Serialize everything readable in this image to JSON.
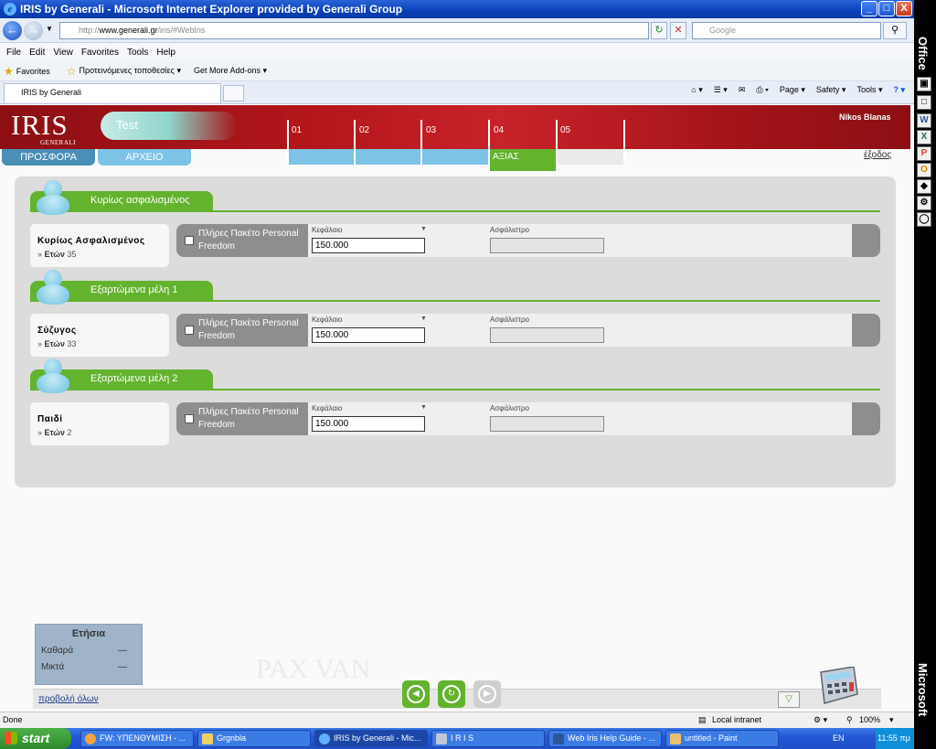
{
  "window": {
    "title": "IRIS by Generali - Microsoft Internet Explorer provided by Generali Group",
    "min_label": "_",
    "max_label": "□",
    "close_label": "X"
  },
  "address_bar": {
    "url_prefix": "http://",
    "url_host": "www.generali.gr",
    "url_path": "/iris/#WebIris",
    "search_placeholder": "Google"
  },
  "menu": [
    "File",
    "Edit",
    "View",
    "Favorites",
    "Tools",
    "Help"
  ],
  "favorites_bar": {
    "favorites": "Favorites",
    "suggested": "Προτεινόμενες τοποθεσίες ▾",
    "addons": "Get More Add-ons ▾"
  },
  "browser_tab": {
    "label": "IRIS by Generali"
  },
  "command_bar": [
    "Page ▾",
    "Safety ▾",
    "Tools ▾"
  ],
  "office_bar": {
    "top_label": "Office",
    "bottom_label": "Microsoft"
  },
  "app": {
    "logo": "IRIS",
    "logo_sub": "GENERALI",
    "project": "Test",
    "user": "Nikos Blanas",
    "steps": [
      "01",
      "02",
      "03",
      "04",
      "05"
    ],
    "active_step": "ΑΞΙΑΣ",
    "tabs": {
      "offer": "ΠΡΟΣΦΟΡΑ",
      "archive": "ΑΡΧΕΙΟ"
    },
    "logout": "έξοδος"
  },
  "sections": [
    {
      "title": "Κυρίως ασφαλισμένος",
      "person": "Κυρίως Ασφαλισμένος",
      "age_label": "Ετών",
      "age": "35",
      "coverage": "Πλήρες Πακέτο Personal Freedom",
      "capital_label": "Κεφάλαιο",
      "capital": "150.000",
      "premium_label": "Ασφάλιστρο"
    },
    {
      "title": "Εξαρτώμενα μέλη 1",
      "person": "Σύζυγος",
      "age_label": "Ετών",
      "age": "33",
      "coverage": "Πλήρες Πακέτο Personal Freedom",
      "capital_label": "Κεφάλαιο",
      "capital": "150.000",
      "premium_label": "Ασφάλιστρο"
    },
    {
      "title": "Εξαρτώμενα μέλη 2",
      "person": "Παιδί",
      "age_label": "Ετών",
      "age": "2",
      "coverage": "Πλήρες Πακέτο Personal Freedom",
      "capital_label": "Κεφάλαιο",
      "capital": "150.000",
      "premium_label": "Ασφάλιστρο"
    }
  ],
  "yearly": {
    "title": "Ετήσια",
    "net_label": "Καθαρά",
    "net_value": "—",
    "gross_label": "Μικτά",
    "gross_value": "—"
  },
  "footer": {
    "view_all": "προβολή όλων",
    "watermark": "PAX     VAN"
  },
  "status": {
    "left": "Done",
    "zone": "Local intranet",
    "zoom": "100%"
  },
  "taskbar": {
    "start": "start",
    "items": [
      "FW: ΥΠΕΝΘΥΜΙΣΗ - ...",
      "Grgnbla",
      "IRIS by Generali - Mic...",
      "I R I S",
      "Web Iris Help Guide - ...",
      "untitled - Paint"
    ],
    "lang": "EN",
    "clock": "11:55 πμ"
  }
}
